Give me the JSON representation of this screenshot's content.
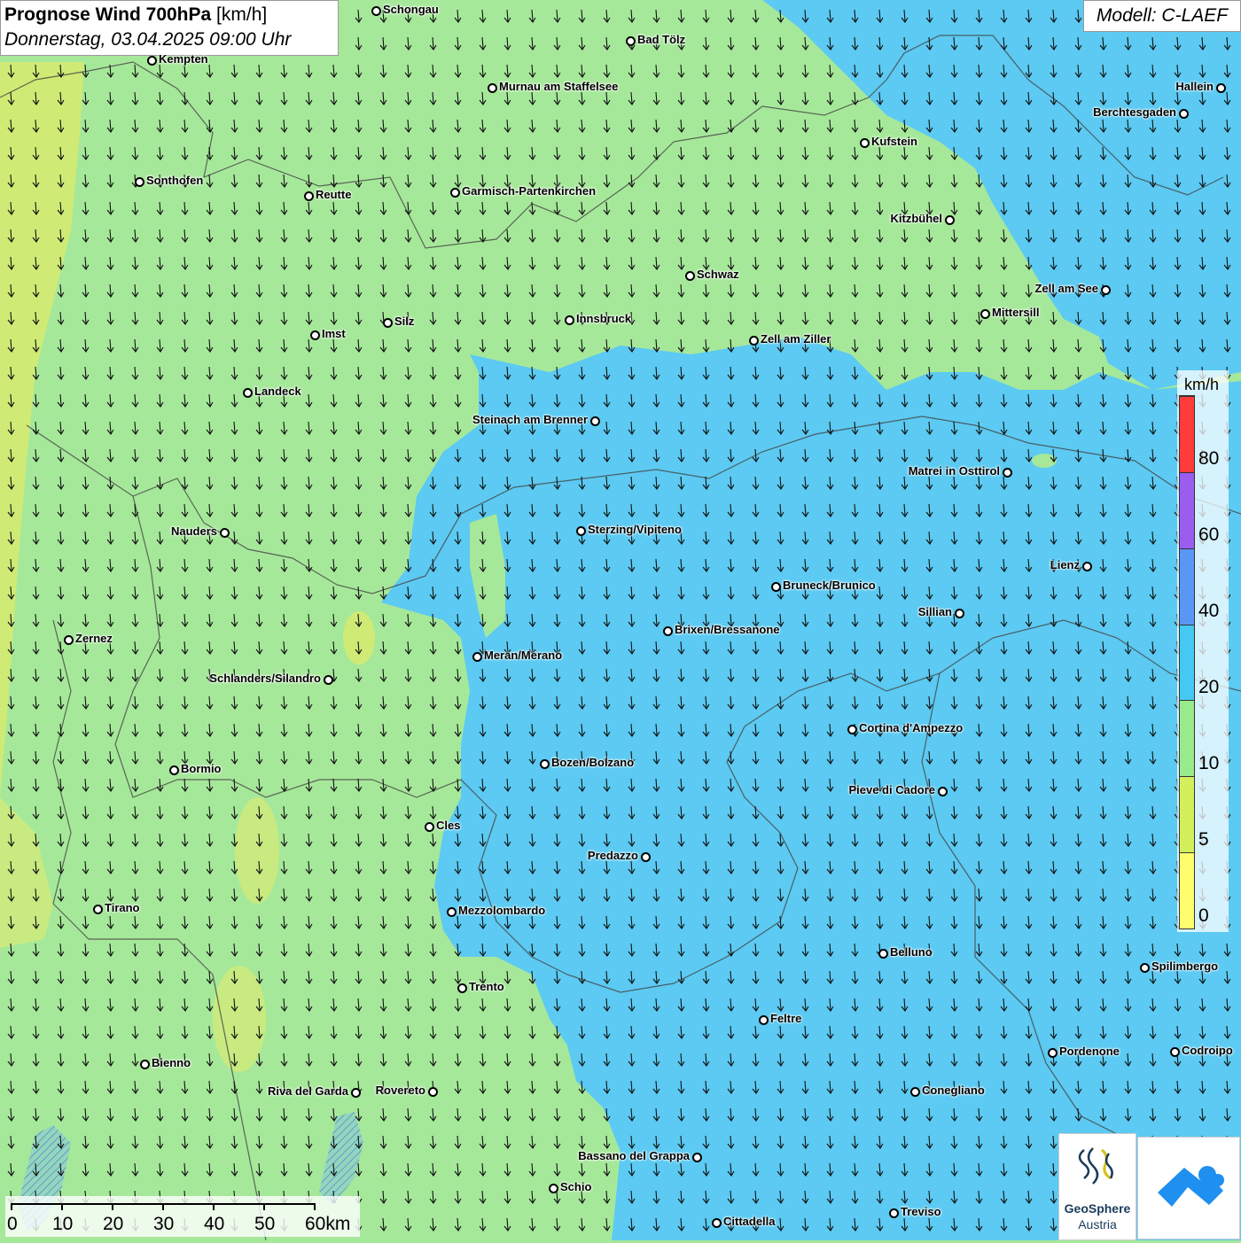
{
  "header": {
    "title_bold": "Prognose Wind 700hPa",
    "title_unit": "[km/h]",
    "datetime": "Donnerstag, 03.04.2025 09:00 Uhr",
    "model": "Modell: C-LAEF"
  },
  "legend": {
    "unit": "km/h",
    "ticks": [
      "80",
      "60",
      "40",
      "20",
      "10",
      "5",
      "0"
    ],
    "colors": [
      "#ff3b3b",
      "#9b5cf0",
      "#5a97f5",
      "#45c9f2",
      "#99ea8c",
      "#d2f05b",
      "#fdfd6e"
    ]
  },
  "map": {
    "wind_arrow_icon": "south-arrow-icon",
    "fill_colors": {
      "light_green": "#a6e89a",
      "light_blue": "#5ccaf2",
      "yellow_green": "#cfeb75"
    },
    "cities": [
      {
        "name": "Schongau"
      },
      {
        "name": "Bad Tölz"
      },
      {
        "name": "Kempten"
      },
      {
        "name": "Murnau am Staffelsee"
      },
      {
        "name": "Hallein"
      },
      {
        "name": "Berchtesgaden"
      },
      {
        "name": "Kufstein"
      },
      {
        "name": "Sonthofen"
      },
      {
        "name": "Reutte"
      },
      {
        "name": "Garmisch-Partenkirchen"
      },
      {
        "name": "Kitzbühel"
      },
      {
        "name": "Schwaz"
      },
      {
        "name": "Zell am See"
      },
      {
        "name": "Mittersill"
      },
      {
        "name": "Innsbruck"
      },
      {
        "name": "Silz"
      },
      {
        "name": "Imst"
      },
      {
        "name": "Zell am Ziller"
      },
      {
        "name": "Landeck"
      },
      {
        "name": "Steinach am Brenner"
      },
      {
        "name": "Matrei in Osttirol"
      },
      {
        "name": "Nauders"
      },
      {
        "name": "Sterzing/Vipiteno"
      },
      {
        "name": "Lienz"
      },
      {
        "name": "Bruneck/Brunico"
      },
      {
        "name": "Sillian"
      },
      {
        "name": "Zernez"
      },
      {
        "name": "Brixen/Bressanone"
      },
      {
        "name": "Meran/Merano"
      },
      {
        "name": "Schlanders/Silandro"
      },
      {
        "name": "Cortina d'Ampezzo"
      },
      {
        "name": "Bozen/Bolzano"
      },
      {
        "name": "Bormio"
      },
      {
        "name": "Pieve di Cadore"
      },
      {
        "name": "Cles"
      },
      {
        "name": "Predazzo"
      },
      {
        "name": "Tirano"
      },
      {
        "name": "Mezzolombardo"
      },
      {
        "name": "Belluno"
      },
      {
        "name": "Spilimbergo"
      },
      {
        "name": "Trento"
      },
      {
        "name": "Feltre"
      },
      {
        "name": "Pordenone"
      },
      {
        "name": "Codroipo"
      },
      {
        "name": "Bienno"
      },
      {
        "name": "Riva del Garda"
      },
      {
        "name": "Rovereto"
      },
      {
        "name": "Conegliano"
      },
      {
        "name": "Bassano del Grappa"
      },
      {
        "name": "Schio"
      },
      {
        "name": "Treviso"
      },
      {
        "name": "Cittadella"
      }
    ]
  },
  "scalebar": {
    "labels": [
      "0",
      "10",
      "20",
      "30",
      "40",
      "50",
      "60km"
    ]
  },
  "logos": {
    "geosphere_line1": "GeoSphere",
    "geosphere_line2": "Austria"
  }
}
